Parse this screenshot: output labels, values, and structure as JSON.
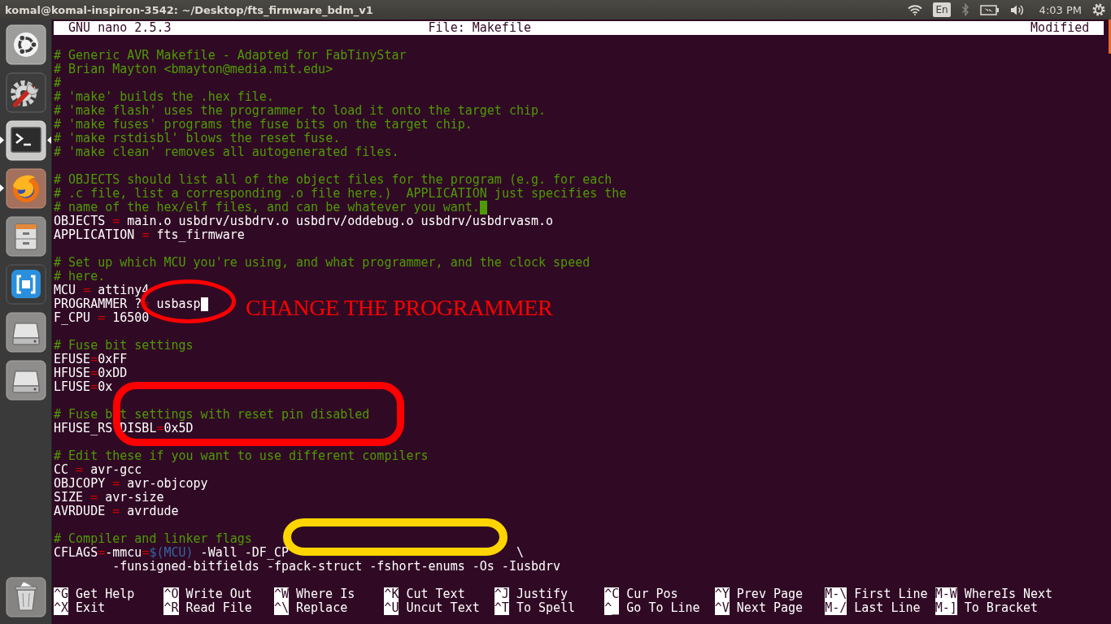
{
  "top_panel": {
    "title": "komal@komal-inspiron-3542: ~/Desktop/fts_firmware_bdm_v1",
    "indicators": [
      {
        "kind": "wifi",
        "disabled": false
      },
      {
        "kind": "keyboard",
        "label": "En",
        "disabled": false
      },
      {
        "kind": "bluetooth",
        "disabled": true
      },
      {
        "kind": "battery",
        "disabled": false
      },
      {
        "kind": "volume",
        "disabled": false
      },
      {
        "kind": "clock",
        "label": "4:03 PM",
        "disabled": false
      },
      {
        "kind": "session",
        "disabled": false
      }
    ]
  },
  "launcher": {
    "items": [
      {
        "kind": "dash",
        "running": false,
        "selected": false
      },
      {
        "kind": "settings",
        "running": false,
        "selected": false
      },
      {
        "kind": "terminal",
        "running": true,
        "selected": true
      },
      {
        "kind": "browser",
        "running": true,
        "selected": false
      },
      {
        "kind": "files",
        "running": false,
        "selected": false
      },
      {
        "kind": "app",
        "running": false,
        "selected": false
      },
      {
        "kind": "drive",
        "running": false,
        "selected": false
      },
      {
        "kind": "drive",
        "running": false,
        "selected": false
      },
      {
        "kind": "trash",
        "running": false,
        "selected": false
      }
    ]
  },
  "nano": {
    "header": {
      "version": "GNU nano 2.5.3",
      "file": "File: Makefile",
      "status": "Modified"
    },
    "blocks": [
      {
        "lines": [
          {
            "kind": "normal",
            "segments": [
              {
                "kind": "comment",
                "text": "# Generic AVR Makefile - Adapted for FabTinyStar"
              }
            ]
          },
          {
            "kind": "normal",
            "segments": [
              {
                "kind": "comment",
                "text": "# Brian Mayton <bmayton@media.mit.edu>"
              }
            ]
          },
          {
            "kind": "normal",
            "segments": [
              {
                "kind": "comment",
                "text": "#"
              }
            ]
          },
          {
            "kind": "normal",
            "segments": [
              {
                "kind": "comment",
                "text": "# 'make' builds the .hex file."
              }
            ]
          },
          {
            "kind": "normal",
            "segments": [
              {
                "kind": "comment",
                "text": "# 'make flash' uses the programmer to load it onto the target chip."
              }
            ]
          },
          {
            "kind": "normal",
            "segments": [
              {
                "kind": "comment",
                "text": "# 'make fuses' programs the fuse bits on the target chip."
              }
            ]
          },
          {
            "kind": "normal",
            "segments": [
              {
                "kind": "comment",
                "text": "# 'make rstdisbl' blows the reset fuse."
              }
            ]
          },
          {
            "kind": "normal",
            "segments": [
              {
                "kind": "comment",
                "text": "# 'make clean' removes all autogenerated files."
              }
            ]
          }
        ]
      },
      {
        "lines": [
          {
            "kind": "normal",
            "segments": [
              {
                "kind": "comment",
                "text": "# OBJECTS should list all of the object files for the program (e.g. for each"
              }
            ]
          },
          {
            "kind": "normal",
            "segments": [
              {
                "kind": "comment",
                "text": "# .c file, list a corresponding .o file here.)  APPLICATION just specifies the"
              }
            ]
          },
          {
            "kind": "normal",
            "segments": [
              {
                "kind": "comment",
                "text": "# name of the hex/elf files, and can be whatever you want."
              },
              {
                "kind": "whitespace"
              }
            ]
          },
          {
            "kind": "normal",
            "segments": [
              {
                "kind": "text",
                "text": "OBJECTS "
              },
              {
                "kind": "operator",
                "text": "="
              },
              {
                "kind": "text",
                "text": " main.o usbdrv/usbdrv.o usbdrv/oddebug.o usbdrv/usbdrvasm.o"
              }
            ]
          },
          {
            "kind": "normal",
            "segments": [
              {
                "kind": "text",
                "text": "APPLICATION "
              },
              {
                "kind": "operator",
                "text": "="
              },
              {
                "kind": "text",
                "text": " fts_firmware"
              }
            ]
          }
        ]
      },
      {
        "lines": [
          {
            "kind": "normal",
            "segments": [
              {
                "kind": "comment",
                "text": "# Set up which MCU you're using, and what programmer, and the clock speed"
              }
            ]
          },
          {
            "kind": "normal",
            "segments": [
              {
                "kind": "comment",
                "text": "# here."
              }
            ]
          },
          {
            "kind": "normal",
            "segments": [
              {
                "kind": "text",
                "text": "MCU "
              },
              {
                "kind": "operator",
                "text": "="
              },
              {
                "kind": "text",
                "text": " attiny4"
              }
            ]
          },
          {
            "kind": "normal",
            "segments": [
              {
                "kind": "text",
                "text": "PROGRAMMER ?"
              },
              {
                "kind": "operator",
                "text": "="
              },
              {
                "kind": "text",
                "text": " usbasp"
              },
              {
                "kind": "cursor"
              }
            ]
          },
          {
            "kind": "normal",
            "segments": [
              {
                "kind": "text",
                "text": "F_CPU "
              },
              {
                "kind": "operator",
                "text": "="
              },
              {
                "kind": "text",
                "text": " 16500"
              }
            ]
          }
        ]
      },
      {
        "lines": [
          {
            "kind": "normal",
            "segments": [
              {
                "kind": "comment",
                "text": "# Fuse bit settings"
              }
            ]
          },
          {
            "kind": "normal",
            "segments": [
              {
                "kind": "text",
                "text": "EFUSE"
              },
              {
                "kind": "operator",
                "text": "="
              },
              {
                "kind": "text",
                "text": "0xFF"
              }
            ]
          },
          {
            "kind": "normal",
            "segments": [
              {
                "kind": "text",
                "text": "HFUSE"
              },
              {
                "kind": "operator",
                "text": "="
              },
              {
                "kind": "text",
                "text": "0xDD"
              }
            ]
          },
          {
            "kind": "normal",
            "segments": [
              {
                "kind": "text",
                "text": "LFUSE"
              },
              {
                "kind": "operator",
                "text": "="
              },
              {
                "kind": "text",
                "text": "0x"
              }
            ]
          }
        ]
      },
      {
        "lines": [
          {
            "kind": "normal",
            "segments": [
              {
                "kind": "comment",
                "text": "# Fuse b"
              },
              {
                "kind": "gap"
              },
              {
                "kind": "comment",
                "text": "t settings with reset pin disabled"
              }
            ]
          },
          {
            "kind": "normal",
            "segments": [
              {
                "kind": "text",
                "text": "HFUSE_RS"
              },
              {
                "kind": "gap"
              },
              {
                "kind": "text",
                "text": "DISBL"
              },
              {
                "kind": "operator",
                "text": "="
              },
              {
                "kind": "text",
                "text": "0x5D"
              }
            ]
          }
        ]
      },
      {
        "lines": [
          {
            "kind": "normal",
            "segments": [
              {
                "kind": "comment",
                "text": "# Edit these if you want to use different compilers"
              }
            ]
          },
          {
            "kind": "normal",
            "segments": [
              {
                "kind": "text",
                "text": "CC "
              },
              {
                "kind": "operator",
                "text": "="
              },
              {
                "kind": "text",
                "text": " avr-gcc"
              }
            ]
          },
          {
            "kind": "normal",
            "segments": [
              {
                "kind": "text",
                "text": "OBJCOPY "
              },
              {
                "kind": "operator",
                "text": "="
              },
              {
                "kind": "text",
                "text": " avr-objcopy"
              }
            ]
          },
          {
            "kind": "normal",
            "segments": [
              {
                "kind": "text",
                "text": "SIZE "
              },
              {
                "kind": "operator",
                "text": "="
              },
              {
                "kind": "text",
                "text": " avr-size"
              }
            ]
          },
          {
            "kind": "normal",
            "segments": [
              {
                "kind": "text",
                "text": "AVRDUDE "
              },
              {
                "kind": "operator",
                "text": "="
              },
              {
                "kind": "text",
                "text": " avrdude"
              }
            ]
          }
        ]
      },
      {
        "lines": [
          {
            "kind": "normal",
            "segments": [
              {
                "kind": "comment",
                "text": "# Compiler and linker flags"
              }
            ]
          },
          {
            "kind": "normal",
            "segments": [
              {
                "kind": "text",
                "text": "CFLAGS"
              },
              {
                "kind": "operator",
                "text": "="
              },
              {
                "kind": "text",
                "text": "-mmcu"
              },
              {
                "kind": "operator",
                "text": "="
              },
              {
                "kind": "variable",
                "text": "$(MCU)"
              },
              {
                "kind": "text",
                "text": " -Wall -DF_CP"
              },
              {
                "kind": "gap"
              },
              {
                "kind": "text",
                "text": "\\"
              }
            ]
          },
          {
            "kind": "continuation",
            "segments": [
              {
                "kind": "text",
                "text": "-funsigned-bitfields -fpack-struct -fshort-enums -Os -Iusbdrv"
              }
            ]
          }
        ]
      }
    ],
    "shortcuts": [
      {
        "key": "^G",
        "label": "Get Help"
      },
      {
        "key": "^O",
        "label": "Write Out"
      },
      {
        "key": "^W",
        "label": "Where Is"
      },
      {
        "key": "^K",
        "label": "Cut Text"
      },
      {
        "key": "^J",
        "label": "Justify"
      },
      {
        "key": "^C",
        "label": "Cur Pos"
      },
      {
        "key": "^Y",
        "label": "Prev Page"
      },
      {
        "key": "M-\\",
        "label": "First Line"
      },
      {
        "key": "M-W",
        "label": "WhereIs Next"
      },
      {
        "key": "^X",
        "label": "Exit"
      },
      {
        "key": "^R",
        "label": "Read File"
      },
      {
        "key": "^\\",
        "label": "Replace"
      },
      {
        "key": "^U",
        "label": "Uncut Text"
      },
      {
        "key": "^T",
        "label": "To Spell"
      },
      {
        "key": "^_",
        "label": "Go To Line"
      },
      {
        "key": "^V",
        "label": "Next Page"
      },
      {
        "key": "M-/",
        "label": "Last Line"
      },
      {
        "key": "M-]",
        "label": "To Bracket"
      }
    ]
  },
  "annotations": [
    {
      "kind": "ellipse",
      "color": "#ff0000"
    },
    {
      "kind": "note",
      "text": "CHANGE THE PROGRAMMER",
      "color": "#ff0000"
    },
    {
      "kind": "rounded_rect",
      "color": "#ff0000"
    },
    {
      "kind": "rounded_rect",
      "color": "#ffd500"
    }
  ]
}
